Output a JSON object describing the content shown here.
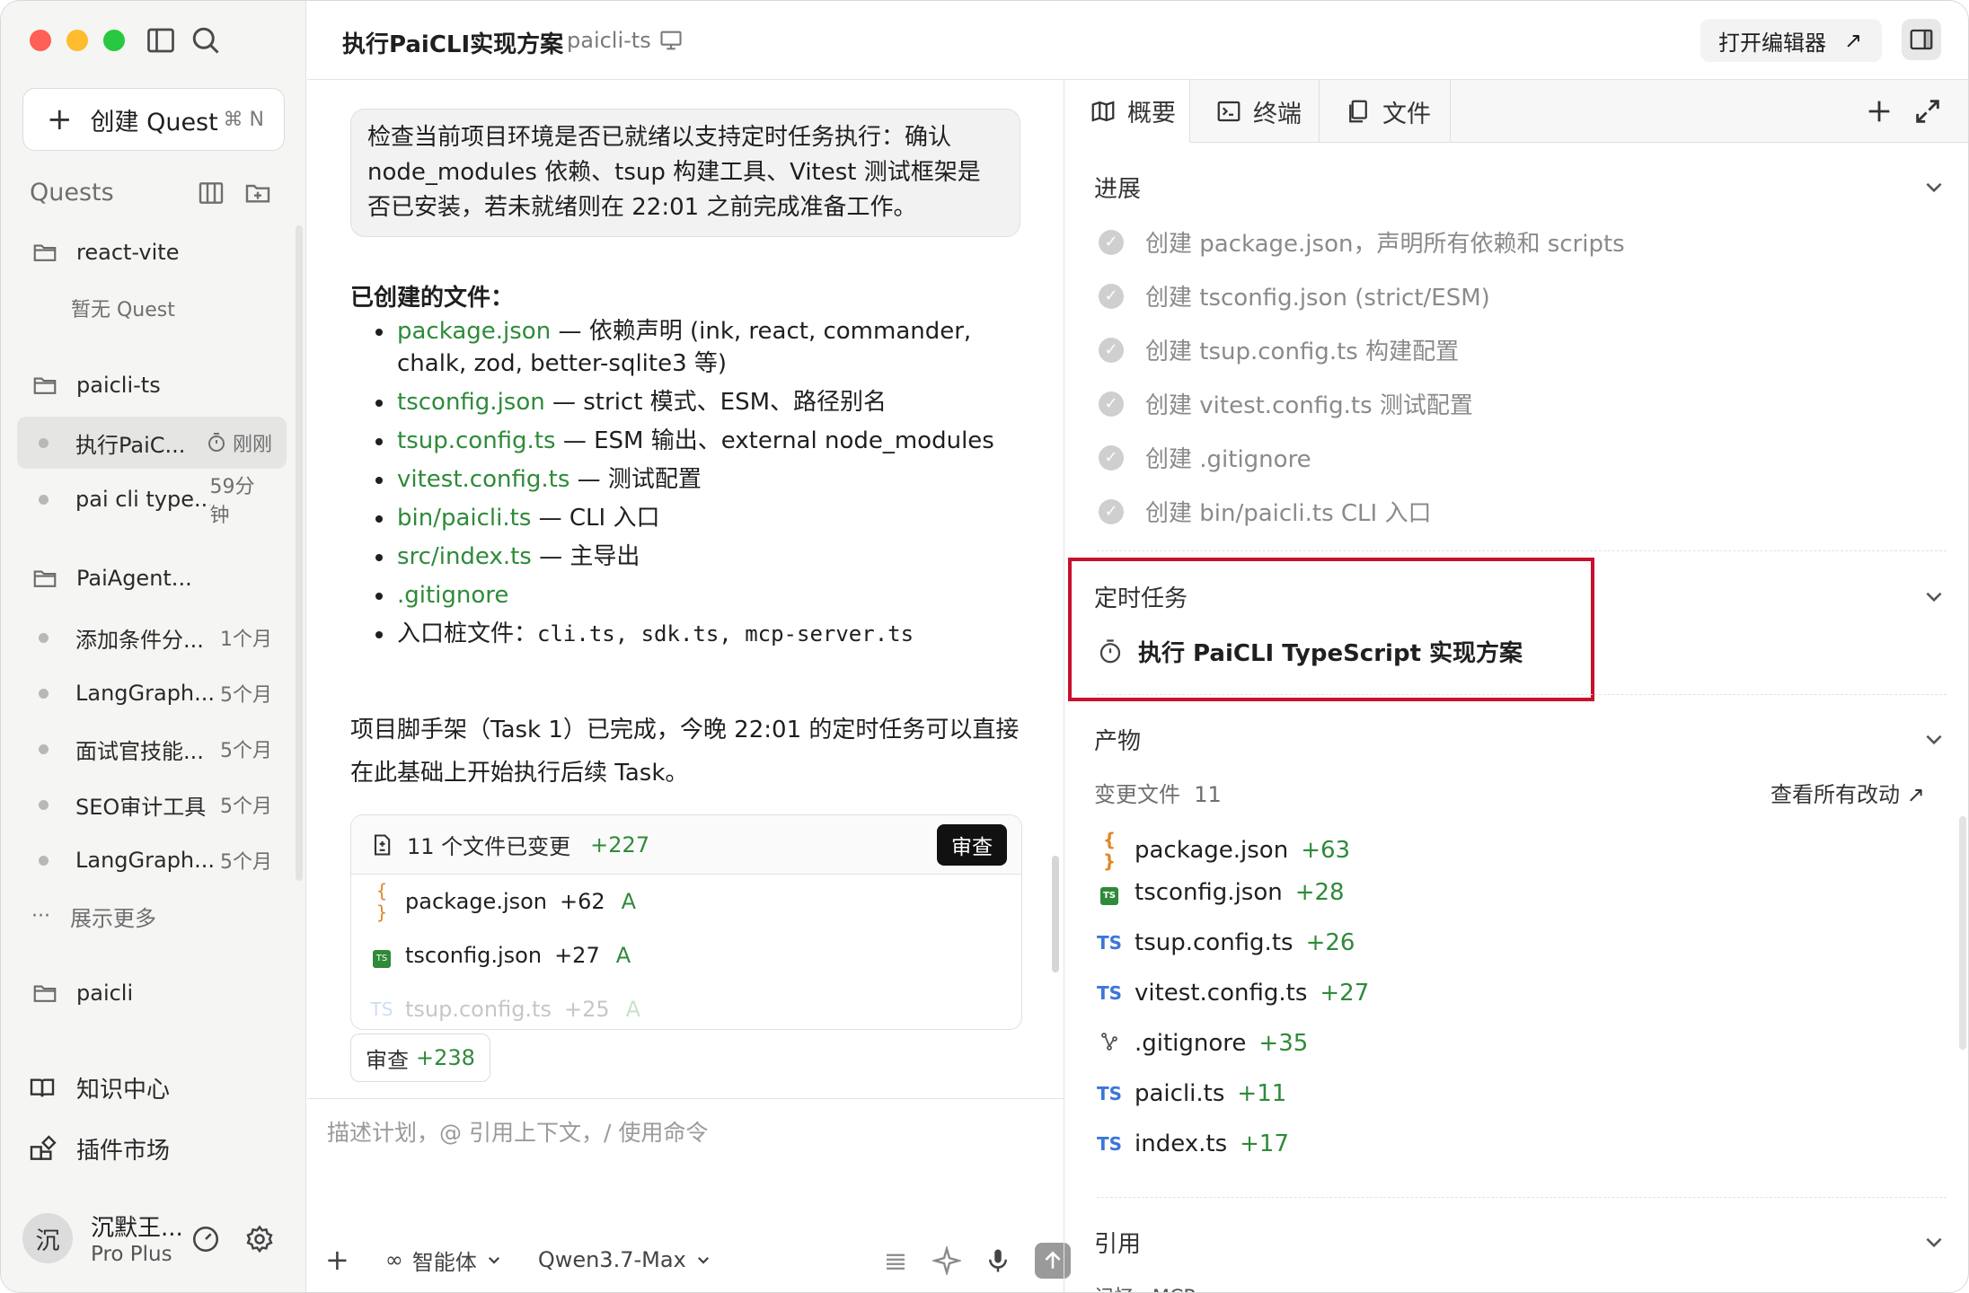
{
  "sidebar": {
    "new_quest_label": "创建 Quest",
    "new_quest_shortcut": "⌘ N",
    "quests_header": "Quests",
    "groups": [
      {
        "name": "react-vite",
        "empty": "暂无 Quest"
      },
      {
        "name": "paicli-ts"
      },
      {
        "name": "PaiAgent..."
      },
      {
        "name": "paicli"
      }
    ],
    "paicli_items": [
      {
        "label": "执行PaiC...",
        "meta": "刚刚"
      },
      {
        "label": "pai cli type...",
        "meta": "59分钟"
      }
    ],
    "paiagent_items": [
      {
        "label": "添加条件分...",
        "meta": "1个月"
      },
      {
        "label": "LangGraph...",
        "meta": "5个月"
      },
      {
        "label": "面试官技能...",
        "meta": "5个月"
      },
      {
        "label": "SEO审计工具",
        "meta": "5个月"
      },
      {
        "label": "LangGraph...",
        "meta": "5个月"
      }
    ],
    "show_more": "展示更多",
    "knowledge": "知识中心",
    "plugins": "插件市场",
    "user": {
      "avatar": "沉",
      "name": "沉默王...",
      "plan": "Pro Plus"
    }
  },
  "header": {
    "title": "执行PaiCLI实现方案",
    "subtitle": "paicli-ts",
    "open_editor": "打开编辑器",
    "open_editor_arrow": "↗"
  },
  "chat": {
    "user_message": "检查当前项目环境是否已就绪以支持定时任务执行：确认 node_modules 依赖、tsup 构建工具、Vitest 测试框架是否已安装，若未就绪则在 22:01 之前完成准备工作。",
    "created_heading": "已创建的文件：",
    "files": [
      {
        "name": "package.json",
        "desc": " — 依赖声明 (ink, react, commander, chalk, zod, better-sqlite3 等)"
      },
      {
        "name": "tsconfig.json",
        "desc": " — strict 模式、ESM、路径别名"
      },
      {
        "name": "tsup.config.ts",
        "desc": " — ESM 输出、external node_modules"
      },
      {
        "name": "vitest.config.ts",
        "desc": " — 测试配置"
      },
      {
        "name": "bin/paicli.ts",
        "desc": " — CLI 入口"
      },
      {
        "name": "src/index.ts",
        "desc": " — 主导出"
      },
      {
        "name": ".gitignore",
        "desc": ""
      }
    ],
    "entry_label": "入口桩文件：",
    "entry_files": "cli.ts, sdk.ts, mcp-server.ts",
    "paragraph": "项目脚手架（Task 1）已完成，今晚 22:01 的定时任务可以直接在此基础上开始执行后续 Task。",
    "changes_summary": "11 个文件已变更",
    "changes_total": "+227",
    "review_label": "审查",
    "change_rows": [
      {
        "icon": "{ }",
        "name": "package.json",
        "add": "+62",
        "status": "A"
      },
      {
        "icon": "TS",
        "name": "tsconfig.json",
        "add": "+27",
        "status": "A"
      },
      {
        "icon": "TS",
        "name": "tsup.config.ts",
        "add": "+25",
        "status": "A"
      }
    ],
    "review_pill_label": "审查",
    "review_pill_count": "+238"
  },
  "input": {
    "placeholder": "描述计划，@ 引用上下文，/ 使用命令",
    "mode": "智能体",
    "model": "Qwen3.7-Max"
  },
  "panel": {
    "tabs": [
      "概要",
      "终端",
      "文件"
    ],
    "progress_title": "进展",
    "progress_items": [
      "创建 package.json，声明所有依赖和 scripts",
      "创建 tsconfig.json (strict/ESM)",
      "创建 tsup.config.ts 构建配置",
      "创建 vitest.config.ts 测试配置",
      "创建 .gitignore",
      "创建 bin/paicli.ts CLI 入口"
    ],
    "scheduled_title": "定时任务",
    "scheduled_item": "执行 PaiCLI TypeScript 实现方案",
    "artifacts_title": "产物",
    "changed_files_label": "变更文件",
    "changed_files_count": "11",
    "view_all": "查看所有改动",
    "artifacts": [
      {
        "icon": "{ }",
        "name": "package.json",
        "add": "+63"
      },
      {
        "icon": "TS",
        "name": "tsconfig.json",
        "add": "+28"
      },
      {
        "icon": "TS",
        "name": "tsup.config.ts",
        "add": "+26"
      },
      {
        "icon": "TS",
        "name": "vitest.config.ts",
        "add": "+27"
      },
      {
        "icon": "git",
        "name": ".gitignore",
        "add": "+35"
      },
      {
        "icon": "TS",
        "name": "paicli.ts",
        "add": "+11"
      },
      {
        "icon": "TS",
        "name": "index.ts",
        "add": "+17"
      }
    ],
    "refs_title": "引用",
    "refs_cut": "记忆 · MCP"
  },
  "colors": {
    "accent_green": "#2f8a3a",
    "highlight_red": "#c8102e"
  }
}
